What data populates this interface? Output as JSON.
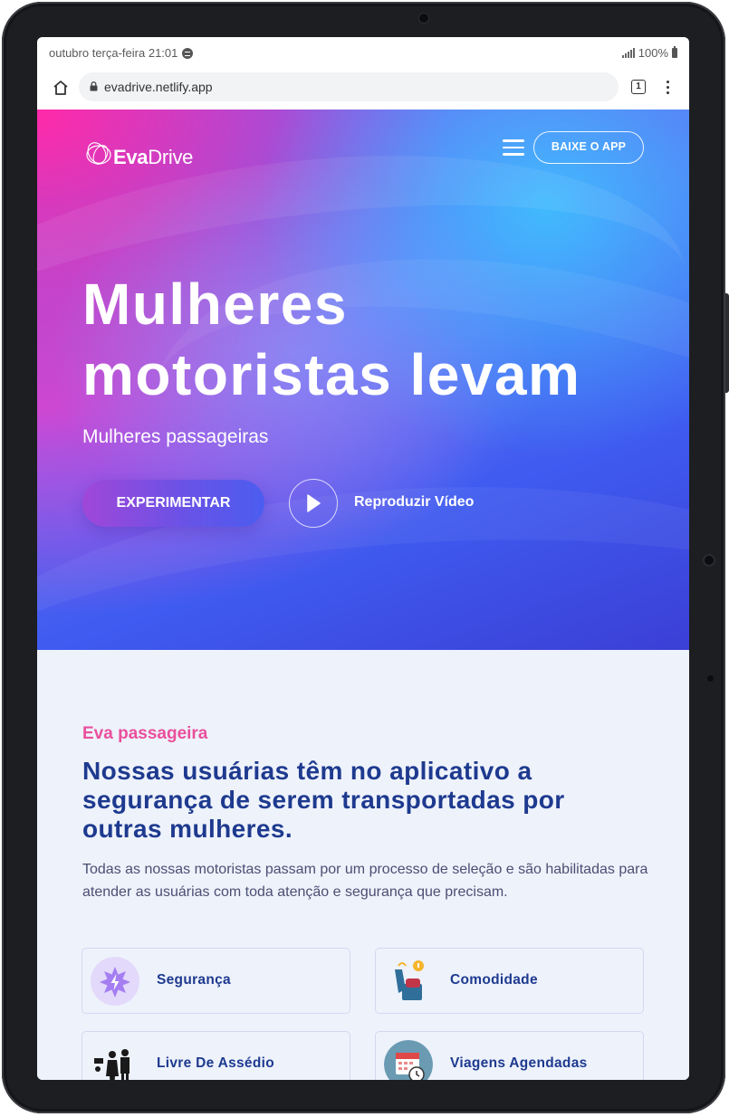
{
  "status_bar": {
    "date_time": "outubro terça-feira 21:01",
    "battery": "100%"
  },
  "browser": {
    "url": "evadrive.netlify.app",
    "tab_count": "1"
  },
  "header": {
    "logo_bold": "Eva",
    "logo_light": "Drive",
    "app_button": "BAIXE O APP"
  },
  "hero": {
    "title": "Mulheres motoristas levam",
    "subtitle": "Mulheres passageiras",
    "primary_button": "EXPERIMENTAR",
    "video_label": "Reproduzir Vídeo"
  },
  "section": {
    "eyebrow": "Eva passageira",
    "title": "Nossas usuárias têm no aplicativo a segurança de serem transportadas por outras mulheres.",
    "description": "Todas as nossas motoristas passam por um processo de seleção e são habilitadas para atender as usuárias com toda atenção e segurança que precisam."
  },
  "features": [
    {
      "label": "Segurança",
      "icon": "shield-star-icon"
    },
    {
      "label": "Comodidade",
      "icon": "seat-icon"
    },
    {
      "label": "Livre De Assédio",
      "icon": "people-icon"
    },
    {
      "label": "Viagens Agendadas",
      "icon": "calendar-icon"
    }
  ],
  "colors": {
    "accent_pink": "#ea4f9c",
    "navy": "#1e3a8f",
    "section_bg": "#eef2fb"
  }
}
